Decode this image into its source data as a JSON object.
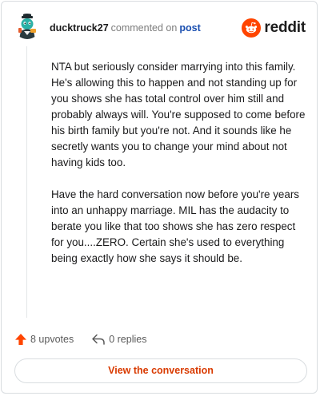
{
  "header": {
    "username": "ducktruck27",
    "commented_text": "commented on",
    "post_link": "post",
    "logo_text": "reddit",
    "brand_color": "#ff4500"
  },
  "comment": {
    "paragraphs": [
      "NTA but seriously consider marrying into this family. He's allowing this to happen and not standing up for you shows she has total control over him still and probably always will. You're supposed to come before his birth family but you're not. And it sounds like he secretly wants you to change your mind about not having kids too.",
      "Have the hard conversation now before you're years into an unhappy marriage. MIL has the audacity to berate you like that too shows she has zero respect for you....ZERO. Certain she's used to everything being exactly how she says it should be."
    ]
  },
  "actions": {
    "upvotes_label": "8 upvotes",
    "replies_label": "0 replies",
    "upvote_icon": "upvote-arrow-icon",
    "reply_icon": "reply-arrow-icon"
  },
  "footer": {
    "view_button_label": "View the conversation"
  }
}
